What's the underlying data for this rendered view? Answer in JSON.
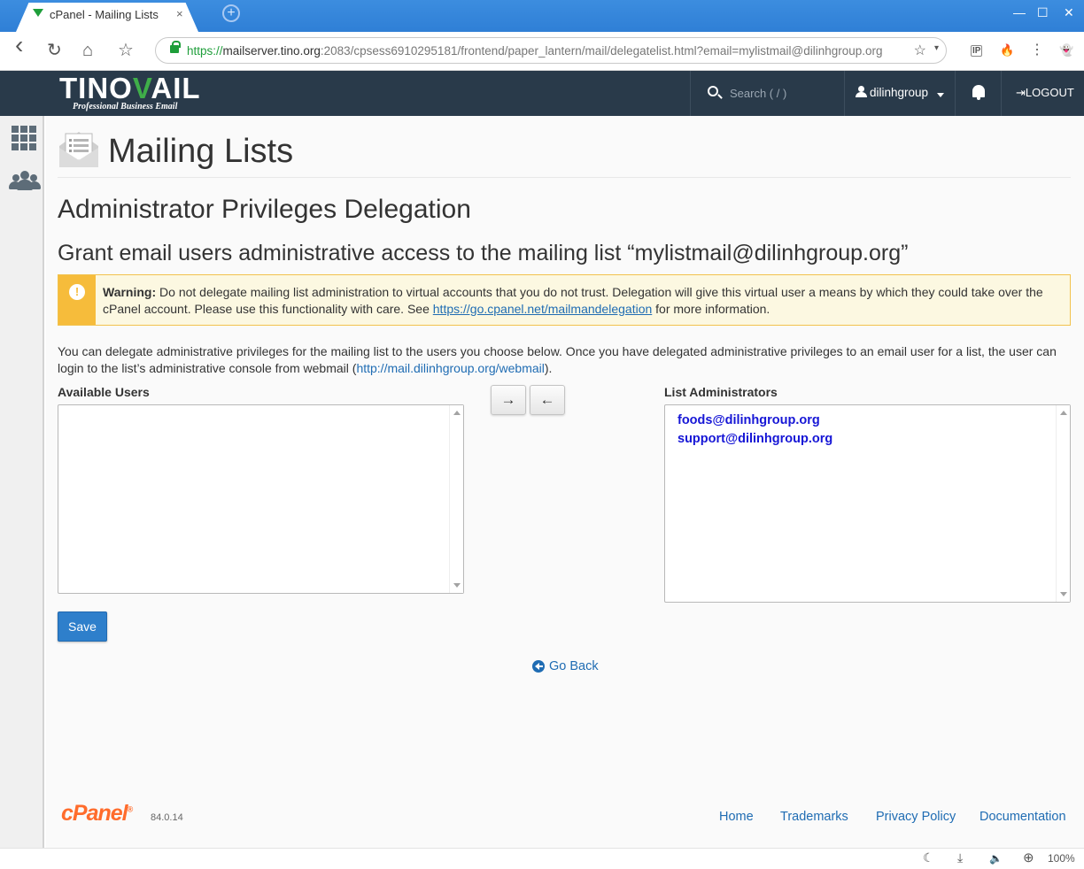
{
  "browser": {
    "tab_title": "cPanel - Mailing Lists",
    "tab_close": "×",
    "new_tab": "+",
    "url_scheme": "https://",
    "url_host": "mailserver.tino.org",
    "url_rest": ":2083/cpsess6910295181/frontend/paper_lantern/mail/delegatelist.html?email=mylistmail@dilinhgroup.org",
    "window_controls": {
      "minimize": "—",
      "maximize": "☐",
      "close": "✕"
    },
    "nav": {
      "back": "‹",
      "reload": "↻",
      "home": "⌂",
      "bookmark": "☆"
    },
    "star": "☆",
    "star_caret": "▾",
    "extensions": [
      "IP",
      "🔥",
      "⋮",
      "👻"
    ],
    "zoom": "100%"
  },
  "header": {
    "logo_text_a": "TINO",
    "logo_text_v": "V",
    "logo_text_b": "AIL",
    "logo_tagline": "Professional Business Email",
    "search_placeholder": "Search ( / )",
    "username": "dilinhgroup",
    "logout_label": "LOGOUT",
    "logout_icon": "⇥"
  },
  "page": {
    "title": "Mailing Lists",
    "heading": "Administrator Privileges Delegation",
    "subheading": "Grant email users administrative access to the mailing list “mylistmail@dilinhgroup.org”",
    "warning": {
      "badge": "!",
      "label": "Warning:",
      "text_before_link": " Do not delegate mailing list administration to virtual accounts that you do not trust. Delegation will give this virtual user a means by which they could take over the cPanel account. Please use this functionality with care. See ",
      "link": "https://go.cpanel.net/mailmandelegation",
      "text_after_link": " for more information."
    },
    "description_before_link": "You can delegate administrative privileges for the mailing list to the users you choose below. Once you have delegated administrative privileges to an email user for a list, the user can login to the list’s administrative console from webmail (",
    "description_link": "http://mail.dilinhgroup.org/webmail",
    "description_after_link": ").",
    "available_users_label": "Available Users",
    "available_users": [],
    "list_admins_label": "List Administrators",
    "list_admins": [
      "foods@dilinhgroup.org",
      "support@dilinhgroup.org"
    ],
    "add_button": "→",
    "remove_button": "←",
    "save_button": "Save",
    "go_back": "Go Back"
  },
  "footer": {
    "brand": "cPanel",
    "brand_mark": "®",
    "version": "84.0.14",
    "links": [
      "Home",
      "Trademarks",
      "Privacy Policy",
      "Documentation"
    ]
  },
  "statusbar": {
    "night": "☾",
    "download": "⤓",
    "sound": "🔈",
    "zoom_icon": "⊕"
  },
  "colors": {
    "header_bg": "#293a4a",
    "accent_blue": "#2e7fcb",
    "link_blue": "#1f6cb3",
    "warning_yellow": "#f6bc3b",
    "cpanel_orange": "#ff6c2c",
    "admin_text": "#1616d6"
  }
}
